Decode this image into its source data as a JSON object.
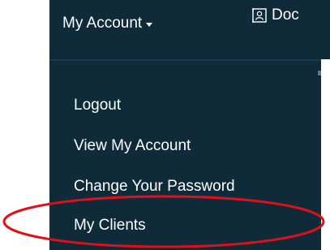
{
  "navbar": {
    "account_label": "My Account",
    "doc_label": "Doc"
  },
  "dropdown": {
    "items": [
      {
        "label": "Logout"
      },
      {
        "label": "View My Account"
      },
      {
        "label": "Change Your Password"
      },
      {
        "label": "My Clients"
      }
    ]
  },
  "colors": {
    "navbar_bg": "#0f2b3a",
    "text": "#ffffff",
    "highlight": "#e0101a"
  },
  "icons": {
    "account_caret": "caret-down-icon",
    "doc": "person-document-icon"
  }
}
